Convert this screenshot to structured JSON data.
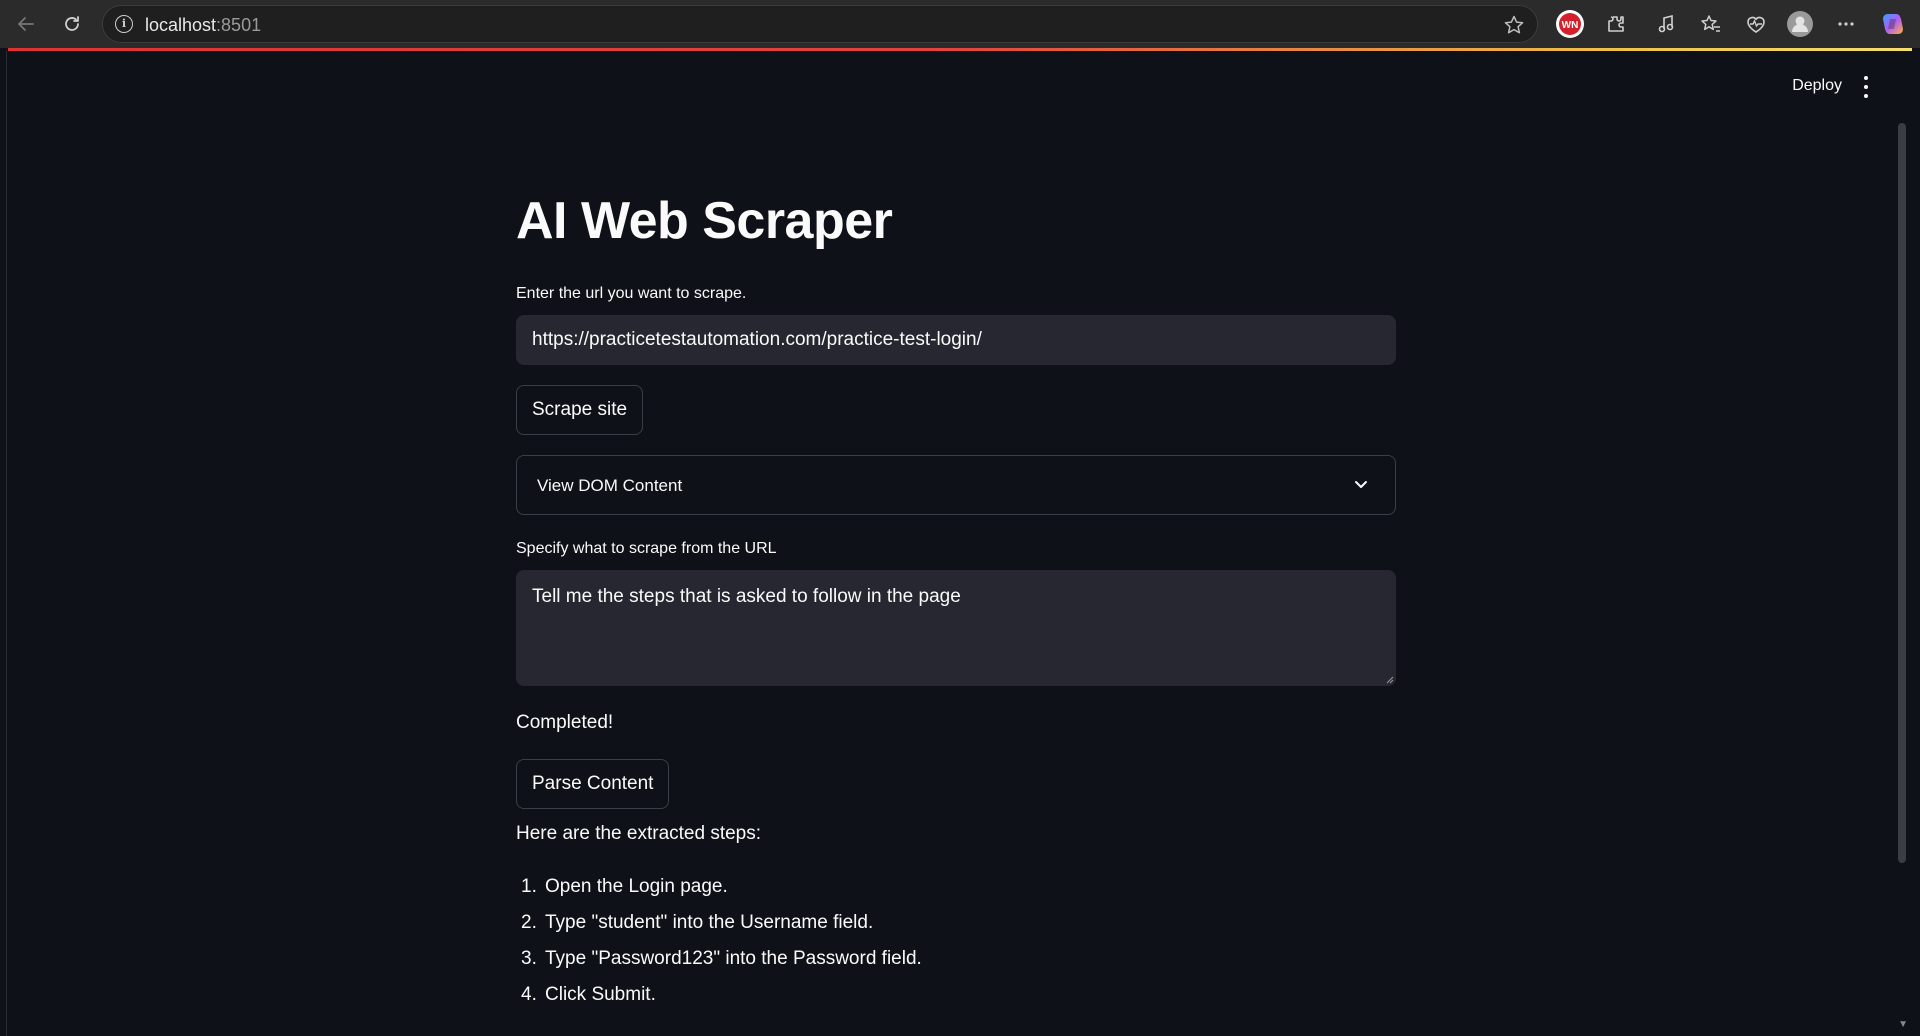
{
  "browser": {
    "url_host": "localhost",
    "url_port": ":8501"
  },
  "app": {
    "deploy_label": "Deploy",
    "title": "AI Web Scraper",
    "url_label": "Enter the url you want to scrape.",
    "url_value": "https://practicetestautomation.com/practice-test-login/",
    "scrape_button": "Scrape site",
    "expander_label": "View DOM Content",
    "query_label": "Specify what to scrape from the URL",
    "query_value": "Tell me the steps that is asked to follow in the page",
    "status": "Completed!",
    "parse_button": "Parse Content",
    "result_intro": "Here are the extracted steps:",
    "steps": [
      {
        "num": "1.",
        "text": "Open the Login page."
      },
      {
        "num": "2.",
        "text": "Type \"student\" into the Username field."
      },
      {
        "num": "3.",
        "text": "Type \"Password123\" into the Password field."
      },
      {
        "num": "4.",
        "text": "Click Submit."
      }
    ]
  },
  "colors": {
    "background": "#0e1117",
    "input_bg": "#262730",
    "text": "#fafafa",
    "border": "#3b3e47"
  }
}
